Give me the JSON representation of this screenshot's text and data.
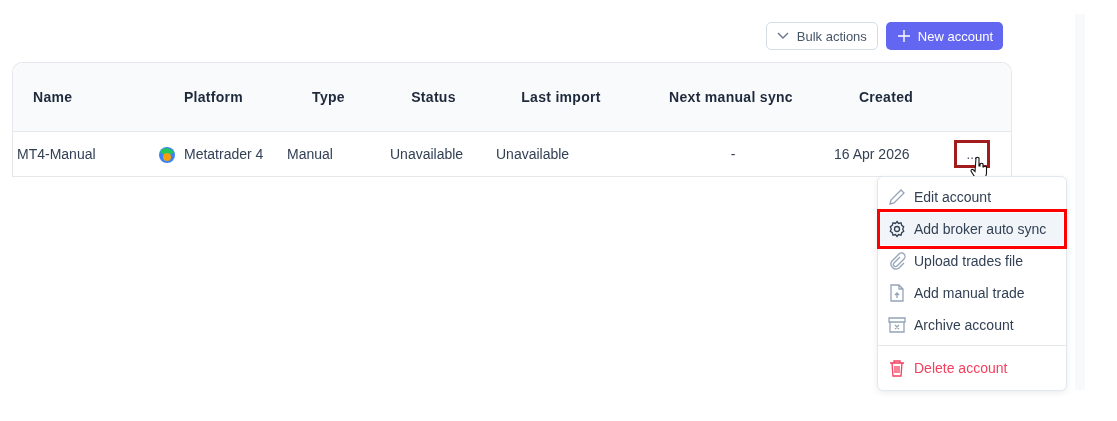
{
  "toolbar": {
    "bulk_actions": "Bulk actions",
    "new_account": "New account"
  },
  "table": {
    "columns": [
      "Name",
      "Platform",
      "Type",
      "Status",
      "Last import",
      "Next manual sync",
      "Created"
    ],
    "rows": [
      {
        "name": "MT4-Manual",
        "platform": "Metatrader 4",
        "type": "Manual",
        "status": "Unavailable",
        "last_import": "Unavailable",
        "next_manual_sync": "-",
        "created": "16 Apr 2026",
        "more": "...",
        "more_highlighted": true
      }
    ]
  },
  "menu": {
    "items": [
      {
        "label": "Edit account",
        "kind": "normal",
        "selected": false,
        "highlighted": false
      },
      {
        "label": "Add broker auto sync",
        "kind": "normal",
        "selected": true,
        "highlighted": true
      },
      {
        "label": "Upload trades file",
        "kind": "normal",
        "selected": false,
        "highlighted": false
      },
      {
        "label": "Add manual trade",
        "kind": "normal",
        "selected": false,
        "highlighted": false
      },
      {
        "label": "Archive account",
        "kind": "normal",
        "selected": false,
        "highlighted": false
      },
      {
        "label": "Delete account",
        "kind": "danger",
        "selected": false,
        "highlighted": false
      }
    ]
  }
}
